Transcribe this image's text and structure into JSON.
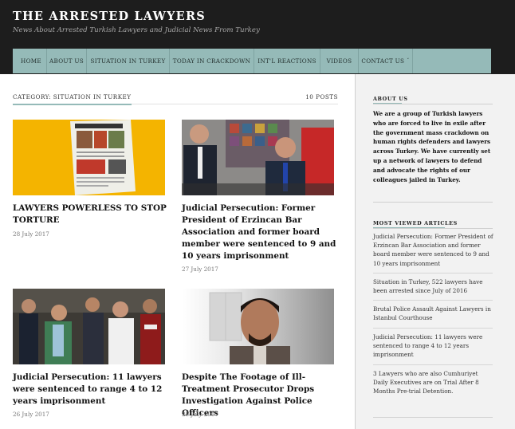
{
  "site": {
    "title": "THE ARRESTED LAWYERS",
    "tagline": "News About Arrested Turkish Lawyers and Judicial News From Turkey"
  },
  "nav": {
    "items": [
      {
        "label": "HOME"
      },
      {
        "label": "ABOUT US"
      },
      {
        "label": "SITUATION IN TURKEY"
      },
      {
        "label": "TODAY IN CRACKDOWN"
      },
      {
        "label": "INT'L REACTIONS"
      },
      {
        "label": "VIDEOS"
      },
      {
        "label": "CONTACT US"
      }
    ]
  },
  "archive": {
    "category_label": "CATEGORY: SITUATION IN TURKEY",
    "posts_count": "10 POSTS"
  },
  "posts": [
    {
      "title": "LAWYERS POWERLESS TO STOP TORTURE",
      "date": "28 July 2017"
    },
    {
      "title": "Judicial Persecution: Former President of Erzincan Bar Association and former board member were sentenced to 9 and 10 years imprisonment",
      "date": "27 July 2017"
    },
    {
      "title": "Judicial Persecution: 11 lawyers were sentenced to range 4 to 12 years imprisonment",
      "date": "26 July 2017"
    },
    {
      "title": "Despite The Footage of Ill-Treatment Prosecutor Drops Investigation Against Police Officers",
      "date": "25 July 2017"
    }
  ],
  "sidebar": {
    "about_title": "ABOUT US",
    "about_text": "We are a group of Turkish lawyers who are forced to live in exile after the government mass crackdown on human rights defenders and lawyers across Turkey. We have currently set up a network of lawyers to defend and advocate the rights of our colleagues jailed in Turkey.",
    "most_viewed_title": "MOST VIEWED ARTICLES",
    "most_viewed": [
      "Judicial Persecution: Former President of Erzincan Bar Association and former board member were sentenced to 9 and 10 years imprisonment",
      "Situation in Turkey, 522 lawyers have been arrested since July of 2016",
      "Brutal Police Assault Against Lawyers in Istanbul Courthouse",
      "Judicial Persecution: 11 lawyers were sentenced to range 4 to 12 years imprisonment",
      "3 Lawyers who are also Cumhuriyet Daily Executives are on Trial After 8 Months Pre-trial Detention."
    ]
  },
  "colors": {
    "header_bg": "#1d1d1d",
    "nav_bg": "#95bab8",
    "sidebar_bg": "#f2f2f2",
    "accent": "#95bab8"
  }
}
